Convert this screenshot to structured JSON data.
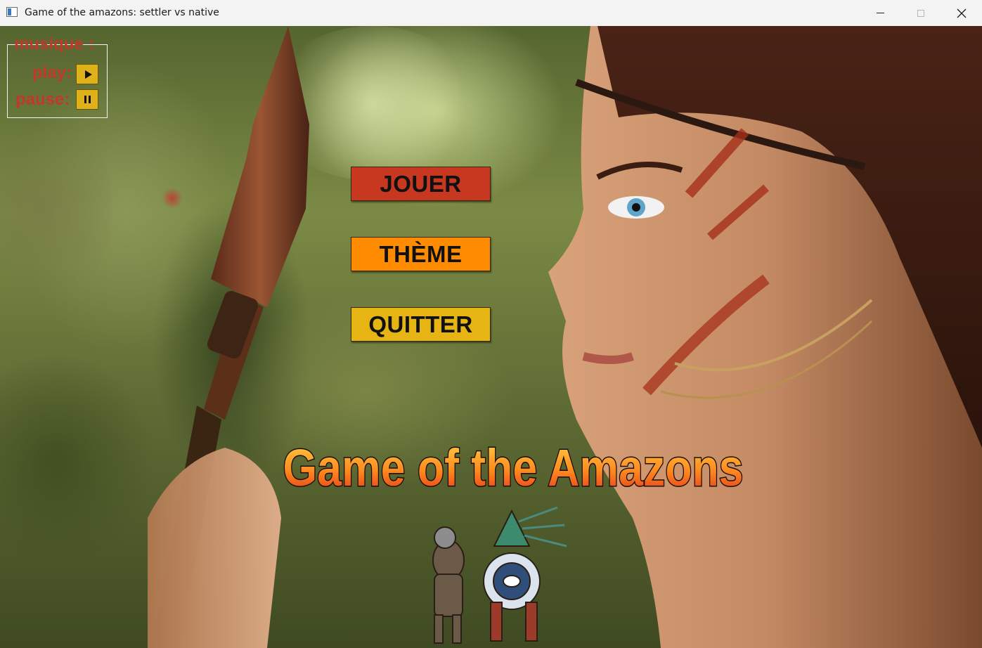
{
  "window": {
    "title": "Game of the amazons: settler vs native",
    "controls": {
      "minimize": "minimize",
      "maximize": "maximize",
      "close": "close"
    }
  },
  "music": {
    "legend": "musique :",
    "play_label": "play:",
    "pause_label": "pause:"
  },
  "menu": {
    "play": "JOUER",
    "theme": "THÈME",
    "quit": "QUITTER"
  },
  "logo": {
    "text": "Game of the Amazons"
  },
  "colors": {
    "accent_text": "#c0392b",
    "jouer": "#c8371f",
    "theme": "#ff8c00",
    "quitter": "#e6b514",
    "mini_button": "#e0b21a"
  },
  "icons": {
    "play": "play-icon",
    "pause": "pause-icon",
    "app": "app-window-icon"
  }
}
